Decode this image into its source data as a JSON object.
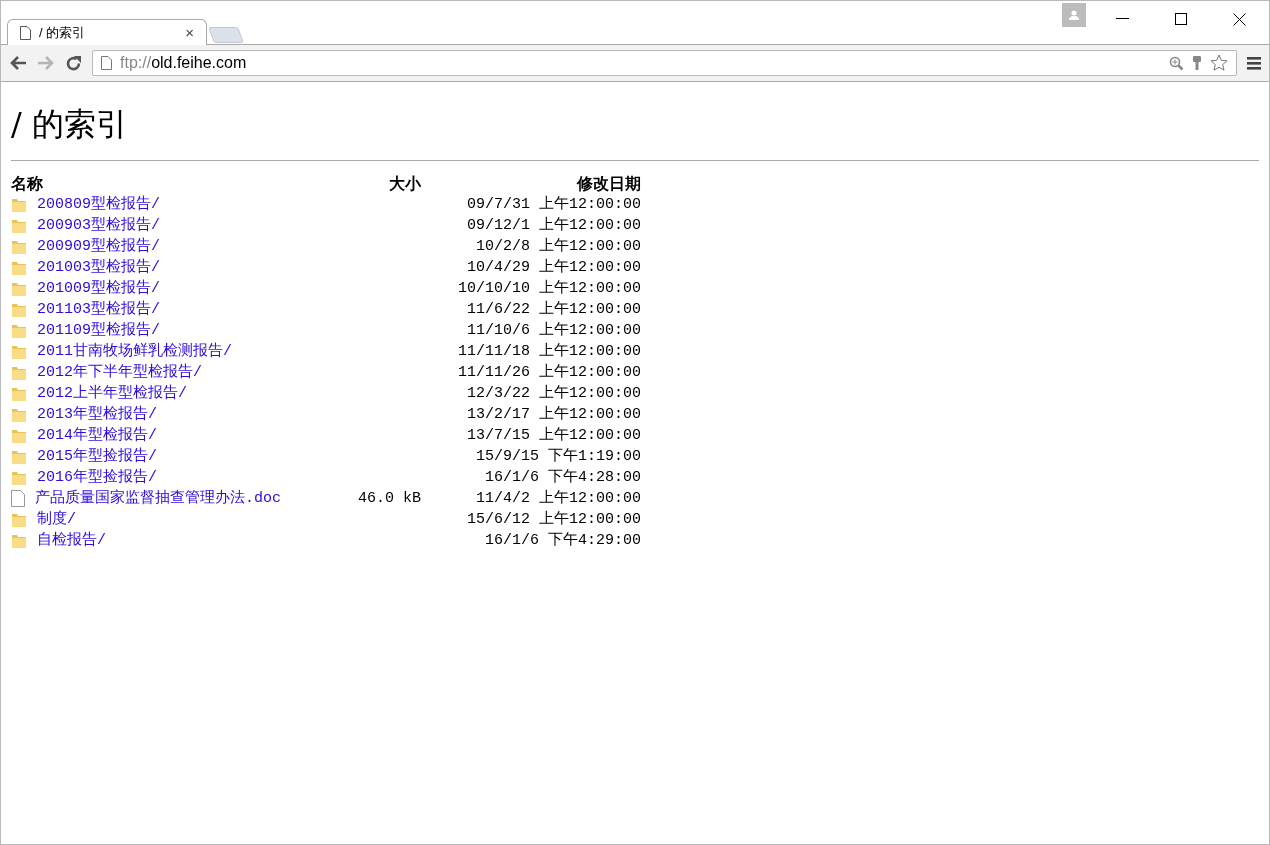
{
  "tab": {
    "title": "/ 的索引",
    "close": "×"
  },
  "address_bar": {
    "scheme": "ftp://",
    "host": "old.feihe.com"
  },
  "heading": "/ 的索引",
  "table": {
    "columns": [
      "名称",
      "大小",
      "修改日期"
    ],
    "rows": [
      {
        "kind": "folder",
        "name": "200809型检报告/",
        "date": "09/7/31 上午12:00:00"
      },
      {
        "kind": "folder",
        "name": "200903型检报告/",
        "date": "09/12/1 上午12:00:00"
      },
      {
        "kind": "folder",
        "name": "200909型检报告/",
        "date": "10/2/8 上午12:00:00"
      },
      {
        "kind": "folder",
        "name": "201003型检报告/",
        "date": "10/4/29 上午12:00:00"
      },
      {
        "kind": "folder",
        "name": "201009型检报告/",
        "date": "10/10/10 上午12:00:00"
      },
      {
        "kind": "folder",
        "name": "201103型检报告/",
        "date": "11/6/22 上午12:00:00"
      },
      {
        "kind": "folder",
        "name": "201109型检报告/",
        "date": "11/10/6 上午12:00:00"
      },
      {
        "kind": "folder",
        "name": "2011甘南牧场鲜乳检测报告/",
        "date": "11/11/18 上午12:00:00"
      },
      {
        "kind": "folder",
        "name": "2012年下半年型检报告/",
        "date": "11/11/26 上午12:00:00"
      },
      {
        "kind": "folder",
        "name": "2012上半年型检报告/",
        "date": "12/3/22 上午12:00:00"
      },
      {
        "kind": "folder",
        "name": "2013年型检报告/",
        "date": "13/2/17 上午12:00:00"
      },
      {
        "kind": "folder",
        "name": "2014年型检报告/",
        "date": "13/7/15 上午12:00:00"
      },
      {
        "kind": "folder",
        "name": "2015年型捡报告/",
        "date": "15/9/15 下午1:19:00"
      },
      {
        "kind": "folder",
        "name": "2016年型捡报告/",
        "date": "16/1/6 下午4:28:00"
      },
      {
        "kind": "file",
        "name": "产品质量国家监督抽查管理办法.doc",
        "size": "46.0 kB",
        "date": "11/4/2 上午12:00:00"
      },
      {
        "kind": "folder",
        "name": "制度/",
        "date": "15/6/12 上午12:00:00"
      },
      {
        "kind": "folder",
        "name": "自检报告/",
        "date": "16/1/6 下午4:29:00"
      }
    ]
  }
}
